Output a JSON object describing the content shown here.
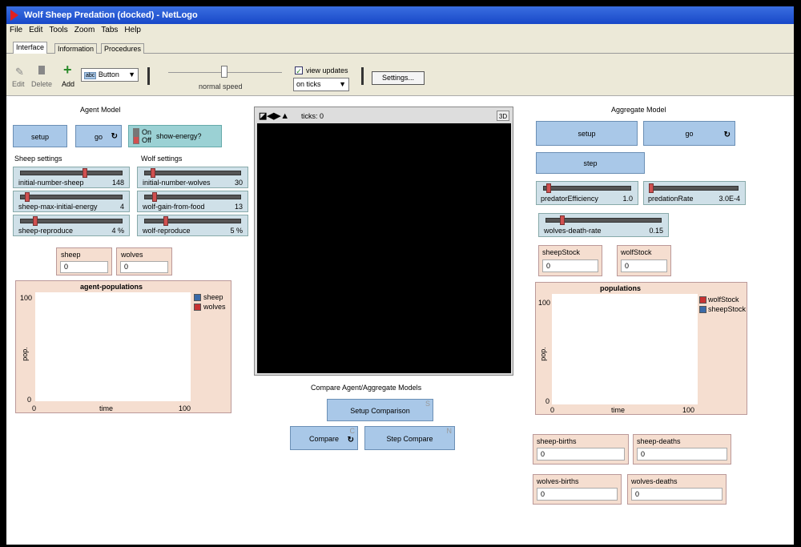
{
  "window": {
    "title": "Wolf Sheep Predation (docked) - NetLogo"
  },
  "menu": [
    "File",
    "Edit",
    "Tools",
    "Zoom",
    "Tabs",
    "Help"
  ],
  "tabs": [
    "Interface",
    "Information",
    "Procedures"
  ],
  "toolbar": {
    "edit": "Edit",
    "delete": "Delete",
    "add": "Add",
    "widget_type": "Button",
    "speed_label": "normal speed",
    "view_updates": "view updates",
    "update_mode": "on ticks",
    "settings": "Settings..."
  },
  "agent": {
    "title": "Agent Model",
    "setup": "setup",
    "go": "go",
    "switch_on": "On",
    "switch_off": "Off",
    "switch_label": "show-energy?",
    "sheep_settings": "Sheep settings",
    "wolf_settings": "Wolf settings",
    "sliders": [
      {
        "label": "initial-number-sheep",
        "value": "148"
      },
      {
        "label": "sheep-max-initial-energy",
        "value": "4"
      },
      {
        "label": "sheep-reproduce",
        "value": "4 %"
      },
      {
        "label": "initial-number-wolves",
        "value": "30"
      },
      {
        "label": "wolf-gain-from-food",
        "value": "13"
      },
      {
        "label": "wolf-reproduce",
        "value": "5 %"
      }
    ],
    "monitors": [
      {
        "label": "sheep",
        "value": "0"
      },
      {
        "label": "wolves",
        "value": "0"
      }
    ],
    "plot": {
      "title": "agent-populations",
      "ymax": "100",
      "ymin": "0",
      "xmin": "0",
      "xmax": "100",
      "xlabel": "time",
      "ylabel": "pop.",
      "legend": [
        {
          "name": "sheep",
          "color": "#3a6aa8"
        },
        {
          "name": "wolves",
          "color": "#c83232"
        }
      ]
    }
  },
  "view": {
    "ticks": "ticks: 0",
    "three_d": "3D"
  },
  "compare": {
    "title": "Compare Agent/Aggregate Models",
    "setup": "Setup Comparison",
    "setup_key": "S",
    "compare": "Compare",
    "compare_key": "C",
    "step": "Step Compare",
    "step_key": "N"
  },
  "aggregate": {
    "title": "Aggregate Model",
    "setup": "setup",
    "go": "go",
    "step": "step",
    "sliders": [
      {
        "label": "predatorEfficiency",
        "value": "1.0"
      },
      {
        "label": "predationRate",
        "value": "3.0E-4"
      },
      {
        "label": "wolves-death-rate",
        "value": "0.15"
      }
    ],
    "monitors": [
      {
        "label": "sheepStock",
        "value": "0"
      },
      {
        "label": "wolfStock",
        "value": "0"
      }
    ],
    "plot": {
      "title": "populations",
      "ymax": "100",
      "ymin": "0",
      "xmin": "0",
      "xmax": "100",
      "xlabel": "time",
      "ylabel": "pop.",
      "legend": [
        {
          "name": "wolfStock",
          "color": "#c83232"
        },
        {
          "name": "sheepStock",
          "color": "#3a6aa8"
        }
      ]
    },
    "bottom_monitors": [
      {
        "label": "sheep-births",
        "value": "0"
      },
      {
        "label": "sheep-deaths",
        "value": "0"
      },
      {
        "label": "wolves-births",
        "value": "0"
      },
      {
        "label": "wolves-deaths",
        "value": "0"
      }
    ]
  }
}
